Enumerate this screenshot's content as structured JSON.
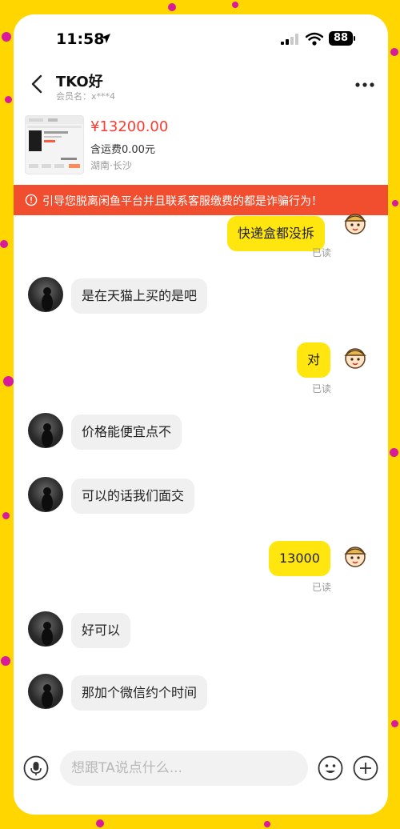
{
  "status_bar": {
    "time": "11:58",
    "battery": "88"
  },
  "header": {
    "title": "TKO好",
    "subtitle": "会员名：x***4"
  },
  "product": {
    "price": "¥13200.00",
    "shipping": "含运费0.00元",
    "location": "湖南·长沙"
  },
  "warning": {
    "text": "引导您脱离闲鱼平台并且联系客服缴费的都是诈骗行为！"
  },
  "messages": [
    {
      "side": "right",
      "text": "快递盒都没拆",
      "status": "已读"
    },
    {
      "side": "left",
      "text": "是在天猫上买的是吧"
    },
    {
      "side": "right",
      "text": "对",
      "status": "已读"
    },
    {
      "side": "left",
      "text": "价格能便宜点不"
    },
    {
      "side": "left",
      "text": "可以的话我们面交"
    },
    {
      "side": "right",
      "text": "13000",
      "status": "已读"
    },
    {
      "side": "left",
      "text": "好可以"
    },
    {
      "side": "left",
      "text": "那加个微信约个时间"
    }
  ],
  "input": {
    "placeholder": "想跟TA说点什么..."
  },
  "icons": [
    "location-arrow-icon",
    "signal-icon",
    "wifi-icon",
    "battery-icon",
    "back-icon",
    "more-icon",
    "warning-icon",
    "mic-icon",
    "emoji-icon",
    "plus-icon"
  ],
  "colors": {
    "accent_yellow": "#ffe60f",
    "price_red": "#ff3b30",
    "warning_red": "#f04e2e"
  }
}
